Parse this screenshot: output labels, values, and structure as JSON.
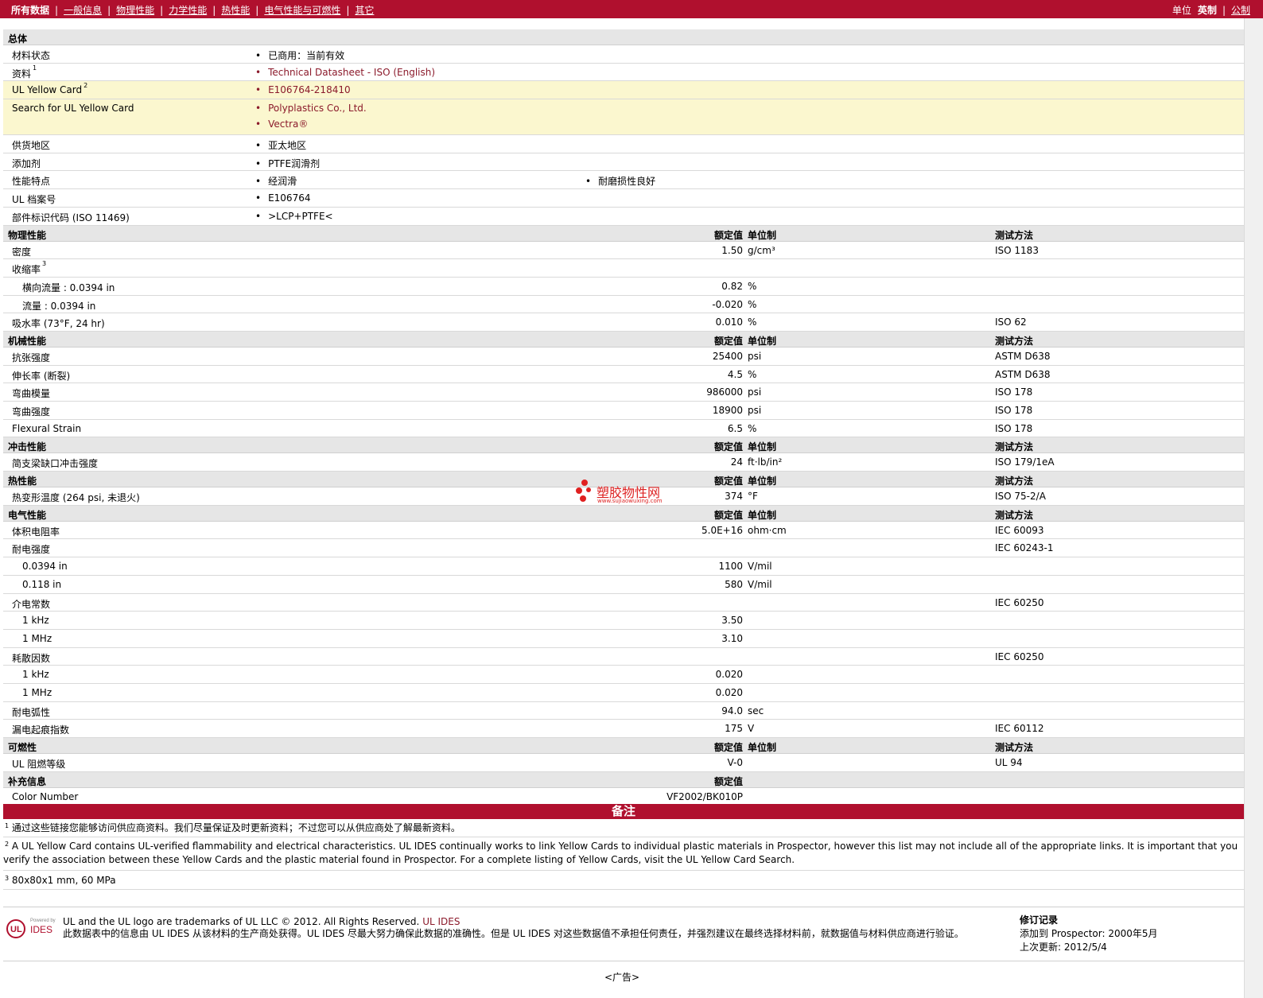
{
  "nav": {
    "items": [
      "所有数据",
      "一般信息",
      "物理性能",
      "力学性能",
      "热性能",
      "电气性能与可燃性",
      "其它"
    ],
    "sep": "|",
    "unit_label": "单位",
    "unit_english": "英制",
    "unit_metric": "公制"
  },
  "general": {
    "title": "总体",
    "material_status_label": "材料状态",
    "material_status_value": "已商用：当前有效",
    "docs_label": "资料",
    "docs_sup": "1",
    "docs_link": "Technical Datasheet - ISO (English)",
    "ulcard_label": "UL Yellow Card",
    "ulcard_sup": "2",
    "ulcard_link": "E106764-218410",
    "search_label": "Search for UL Yellow Card",
    "search_link1": "Polyplastics Co., Ltd.",
    "search_link2": "Vectra®",
    "region_label": "供货地区",
    "region_value": "亚太地区",
    "additive_label": "添加剂",
    "additive_value": "PTFE润滑剂",
    "features_label": "性能特点",
    "features_value1": "经润滑",
    "features_value2": "耐磨损性良好",
    "ulfile_label": "UL 档案号",
    "ulfile_value": "E106764",
    "partcode_label": "部件标识代码",
    "partcode_note": "(ISO 11469)",
    "partcode_value": ">LCP+PTFE<"
  },
  "headers": {
    "nominal": "额定值",
    "unit": "单位制",
    "method": "测试方法"
  },
  "physical": {
    "title": "物理性能",
    "density_label": "密度",
    "density_value": "1.50",
    "density_unit": "g/cm³",
    "density_method": "ISO 1183",
    "shrink_label": "收缩率",
    "shrink_sup": "3",
    "shrink_td_label": "横向流量 : 0.0394 in",
    "shrink_td_value": "0.82",
    "shrink_td_unit": "%",
    "shrink_fd_label": "流量 : 0.0394 in",
    "shrink_fd_value": "-0.020",
    "shrink_fd_unit": "%",
    "water_label": "吸水率",
    "water_note": "(73°F, 24 hr)",
    "water_value": "0.010",
    "water_unit": "%",
    "water_method": "ISO 62"
  },
  "mechanical": {
    "title": "机械性能",
    "tensile_label": "抗张强度",
    "tensile_value": "25400",
    "tensile_unit": "psi",
    "tensile_method": "ASTM D638",
    "elong_label": "伸长率",
    "elong_note": "(断裂)",
    "elong_value": "4.5",
    "elong_unit": "%",
    "elong_method": "ASTM D638",
    "flexmod_label": "弯曲模量",
    "flexmod_value": "986000",
    "flexmod_unit": "psi",
    "flexmod_method": "ISO 178",
    "flexstr_label": "弯曲强度",
    "flexstr_value": "18900",
    "flexstr_unit": "psi",
    "flexstr_method": "ISO 178",
    "flexstrain_label": "Flexural Strain",
    "flexstrain_value": "6.5",
    "flexstrain_unit": "%",
    "flexstrain_method": "ISO 178"
  },
  "impact": {
    "title": "冲击性能",
    "charpy_label": "简支梁缺口冲击强度",
    "charpy_value": "24",
    "charpy_unit": "ft·lb/in²",
    "charpy_method": "ISO 179/1eA"
  },
  "thermal": {
    "title": "热性能",
    "hdt_label": "热变形温度",
    "hdt_note": "(264 psi, 未退火)",
    "hdt_value": "374",
    "hdt_unit": "°F",
    "hdt_method": "ISO 75-2/A"
  },
  "electrical": {
    "title": "电气性能",
    "volres_label": "体积电阻率",
    "volres_value": "5.0E+16",
    "volres_unit": "ohm·cm",
    "volres_method": "IEC 60093",
    "dielstr_label": "耐电强度",
    "dielstr_method": "IEC 60243-1",
    "dielstr1_label": "0.0394 in",
    "dielstr1_value": "1100",
    "dielstr1_unit": "V/mil",
    "dielstr2_label": "0.118 in",
    "dielstr2_value": "580",
    "dielstr2_unit": "V/mil",
    "dielconst_label": "介电常数",
    "dielconst_method": "IEC 60250",
    "dielconst1_label": "1 kHz",
    "dielconst1_value": "3.50",
    "dielconst2_label": "1 MHz",
    "dielconst2_value": "3.10",
    "dissip_label": "耗散因数",
    "dissip_method": "IEC 60250",
    "dissip1_label": "1 kHz",
    "dissip1_value": "0.020",
    "dissip2_label": "1 MHz",
    "dissip2_value": "0.020",
    "arc_label": "耐电弧性",
    "arc_value": "94.0",
    "arc_unit": "sec",
    "cti_label": "漏电起痕指数",
    "cti_value": "175",
    "cti_unit": "V",
    "cti_method": "IEC 60112"
  },
  "flammability": {
    "title": "可燃性",
    "ul94_label": "UL 阻燃等级",
    "ul94_value": "V-0",
    "ul94_method": "UL 94"
  },
  "supplemental": {
    "title": "补充信息",
    "color_label": "Color Number",
    "color_value": "VF2002/BK010P"
  },
  "notes": {
    "title": "备注",
    "n1_sup": "1",
    "n1_text": "通过这些链接您能够访问供应商资料。我们尽量保证及时更新资料；不过您可以从供应商处了解最新资料。",
    "n2_sup": "2",
    "n2_text": "A UL Yellow Card contains UL-verified flammability and electrical characteristics. UL IDES continually works to link Yellow Cards to individual plastic materials in Prospector, however this list may not include all of the appropriate links. It is important that you verify the association between these Yellow Cards and the plastic material found in Prospector. For a complete listing of Yellow Cards, visit the UL Yellow Card Search.",
    "n3_sup": "3",
    "n3_text": "80x80x1 mm, 60 MPa"
  },
  "footer": {
    "logo_powered": "Powered by",
    "logo_ul": "UL",
    "logo_ides": "IDES",
    "legal_line1": "UL and the UL logo are trademarks of UL LLC © 2012. All Rights Reserved.",
    "legal_link": "UL IDES",
    "legal_line2": "此数据表中的信息由 UL IDES 从该材料的生产商处获得。UL IDES 尽最大努力确保此数据的准确性。但是 UL IDES 对这些数据值不承担任何责任，并强烈建议在最终选择材料前，就数据值与材料供应商进行验证。",
    "rev_title": "修订记录",
    "rev_added": "添加到 Prospector:   2000年5月",
    "rev_updated": "上次更新:   2012/5/4"
  },
  "ad_label": "<广告>",
  "watermark": {
    "text": "塑胶物性网",
    "url": "www.sujiaowuxing.com"
  }
}
